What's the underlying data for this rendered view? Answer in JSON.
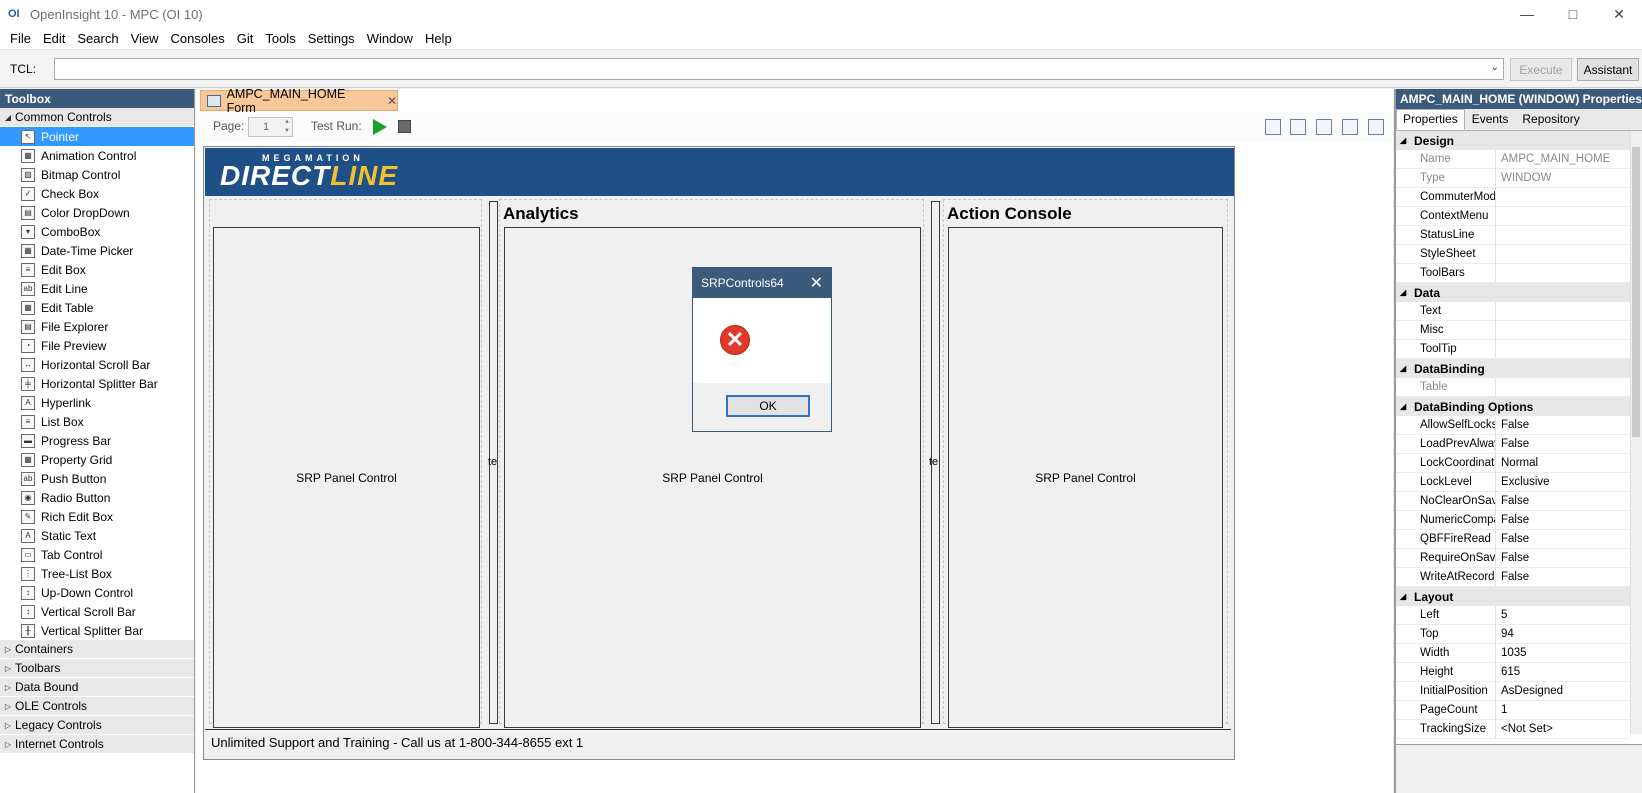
{
  "window": {
    "title": "OpenInsight 10 - MPC (OI 10)",
    "icon_label": "OI",
    "controls": [
      "minimize-icon",
      "maximize-icon",
      "close-icon"
    ]
  },
  "menu": [
    "File",
    "Edit",
    "Search",
    "View",
    "Consoles",
    "Git",
    "Tools",
    "Settings",
    "Window",
    "Help"
  ],
  "tcl": {
    "label": "TCL:",
    "value": "",
    "execute": "Execute",
    "assistant": "Assistant"
  },
  "toolbox": {
    "title": "Toolbox",
    "common_group": "Common Controls",
    "items": [
      {
        "label": "Pointer",
        "icon": "pointer-icon",
        "glyph": "↖"
      },
      {
        "label": "Animation Control",
        "icon": "film-icon",
        "glyph": "▦"
      },
      {
        "label": "Bitmap Control",
        "icon": "picture-icon",
        "glyph": "▨"
      },
      {
        "label": "Check Box",
        "icon": "checkbox-icon",
        "glyph": "✓"
      },
      {
        "label": "Color DropDown",
        "icon": "color-icon",
        "glyph": "▤"
      },
      {
        "label": "ComboBox",
        "icon": "combobox-icon",
        "glyph": "▾"
      },
      {
        "label": "Date-Time Picker",
        "icon": "calendar-icon",
        "glyph": "▦"
      },
      {
        "label": "Edit Box",
        "icon": "editbox-icon",
        "glyph": "≡"
      },
      {
        "label": "Edit Line",
        "icon": "editline-icon",
        "glyph": "ab"
      },
      {
        "label": "Edit Table",
        "icon": "table-icon",
        "glyph": "▦"
      },
      {
        "label": "File Explorer",
        "icon": "folder-icon",
        "glyph": "▤"
      },
      {
        "label": "File Preview",
        "icon": "magnifier-icon",
        "glyph": "◔"
      },
      {
        "label": "Horizontal Scroll Bar",
        "icon": "hscroll-icon",
        "glyph": "↔"
      },
      {
        "label": "Horizontal Splitter Bar",
        "icon": "hsplit-icon",
        "glyph": "╪"
      },
      {
        "label": "Hyperlink",
        "icon": "hyperlink-icon",
        "glyph": "A"
      },
      {
        "label": "List Box",
        "icon": "listbox-icon",
        "glyph": "≡"
      },
      {
        "label": "Progress Bar",
        "icon": "progress-icon",
        "glyph": "▬"
      },
      {
        "label": "Property Grid",
        "icon": "grid-icon",
        "glyph": "▦"
      },
      {
        "label": "Push Button",
        "icon": "button-icon",
        "glyph": "ab"
      },
      {
        "label": "Radio Button",
        "icon": "radio-icon",
        "glyph": "◉"
      },
      {
        "label": "Rich Edit Box",
        "icon": "richedit-icon",
        "glyph": "✎"
      },
      {
        "label": "Static Text",
        "icon": "static-text-icon",
        "glyph": "A"
      },
      {
        "label": "Tab Control",
        "icon": "tab-icon",
        "glyph": "▭"
      },
      {
        "label": "Tree-List Box",
        "icon": "tree-icon",
        "glyph": "⋮"
      },
      {
        "label": "Up-Down Control",
        "icon": "updown-icon",
        "glyph": "↕"
      },
      {
        "label": "Vertical Scroll Bar",
        "icon": "vscroll-icon",
        "glyph": "↕"
      },
      {
        "label": "Vertical Splitter Bar",
        "icon": "vsplit-icon",
        "glyph": "╫"
      }
    ],
    "groups": [
      "Containers",
      "Toolbars",
      "Data Bound",
      "OLE Controls",
      "Legacy Controls",
      "Internet Controls"
    ]
  },
  "designer": {
    "tab": "AMPC_MAIN_HOME Form",
    "page_label": "Page:",
    "page_value": "1",
    "test_run_label": "Test Run:"
  },
  "form": {
    "banner_top": "MEGAMATION",
    "banner_main_a": "DIRECT",
    "banner_main_b": "LINE",
    "analytics_title": "Analytics",
    "action_title": "Action Console",
    "panel_label": "SRP Panel Control",
    "footer": "Unlimited Support and Training - Call us at 1-800-344-8655 ext 1",
    "splitter_label": "te"
  },
  "dialog": {
    "title": "SRPControls64",
    "ok": "OK"
  },
  "properties": {
    "header": "AMPC_MAIN_HOME (WINDOW) Properties",
    "tabs": [
      "Properties",
      "Events",
      "Repository"
    ],
    "categories": {
      "design": "Design",
      "data": "Data",
      "databinding": "DataBinding",
      "dboptions": "DataBinding Options",
      "layout": "Layout"
    },
    "design": [
      {
        "name": "Name",
        "value": "AMPC_MAIN_HOME"
      },
      {
        "name": "Type",
        "value": "WINDOW"
      },
      {
        "name": "CommuterModule",
        "value": ""
      },
      {
        "name": "ContextMenu",
        "value": ""
      },
      {
        "name": "StatusLine",
        "value": ""
      },
      {
        "name": "StyleSheet",
        "value": ""
      },
      {
        "name": "ToolBars",
        "value": ""
      }
    ],
    "data": [
      {
        "name": "Text",
        "value": ""
      },
      {
        "name": "Misc",
        "value": ""
      },
      {
        "name": "ToolTip",
        "value": ""
      }
    ],
    "databinding": [
      {
        "name": "Table",
        "value": ""
      }
    ],
    "dboptions": [
      {
        "name": "AllowSelfLocks",
        "value": "False"
      },
      {
        "name": "LoadPrevAlways",
        "value": "False"
      },
      {
        "name": "LockCoordination",
        "value": "Normal"
      },
      {
        "name": "LockLevel",
        "value": "Exclusive"
      },
      {
        "name": "NoClearOnSave",
        "value": "False"
      },
      {
        "name": "NumericCompare",
        "value": "False"
      },
      {
        "name": "QBFFireRead",
        "value": "False"
      },
      {
        "name": "RequireOnSave",
        "value": "False"
      },
      {
        "name": "WriteAtRecord",
        "value": "False"
      }
    ],
    "layout": [
      {
        "name": "Left",
        "value": "5"
      },
      {
        "name": "Top",
        "value": "94"
      },
      {
        "name": "Width",
        "value": "1035"
      },
      {
        "name": "Height",
        "value": "615"
      },
      {
        "name": "InitialPosition",
        "value": "AsDesigned"
      },
      {
        "name": "PageCount",
        "value": "1"
      },
      {
        "name": "TrackingSize",
        "value": "<Not Set>"
      }
    ]
  }
}
